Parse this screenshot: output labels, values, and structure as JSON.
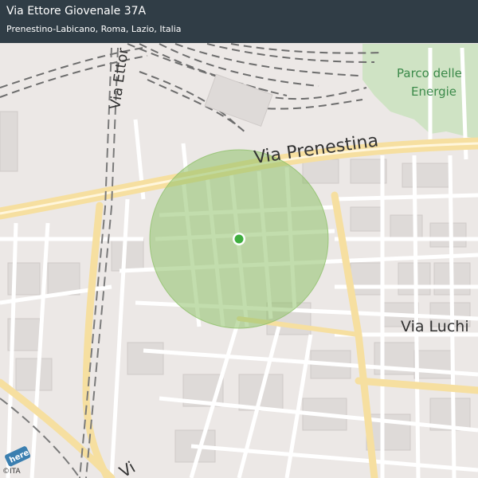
{
  "header": {
    "title": "Via Ettore Giovenale 37A",
    "subtitle": "Prenestino-Labicano, Roma, Lazio, Italia"
  },
  "map": {
    "labels": {
      "via_prenestina": "Via Prenestina",
      "via_luchino": "Via Luchi",
      "via_ettore": "Via Ettor",
      "via_bottom": "Vi",
      "park_line1": "Parco delle",
      "park_line2": "Energie"
    },
    "logo": "here",
    "copyright": "©ITA",
    "colors": {
      "background": "#ece8e6",
      "major_road": "#fbe6a6",
      "park": "#cfe3c4",
      "radius_fill": "#8fc16a",
      "marker": "#3fae3f"
    },
    "marker_icon": "location-dot-icon"
  }
}
